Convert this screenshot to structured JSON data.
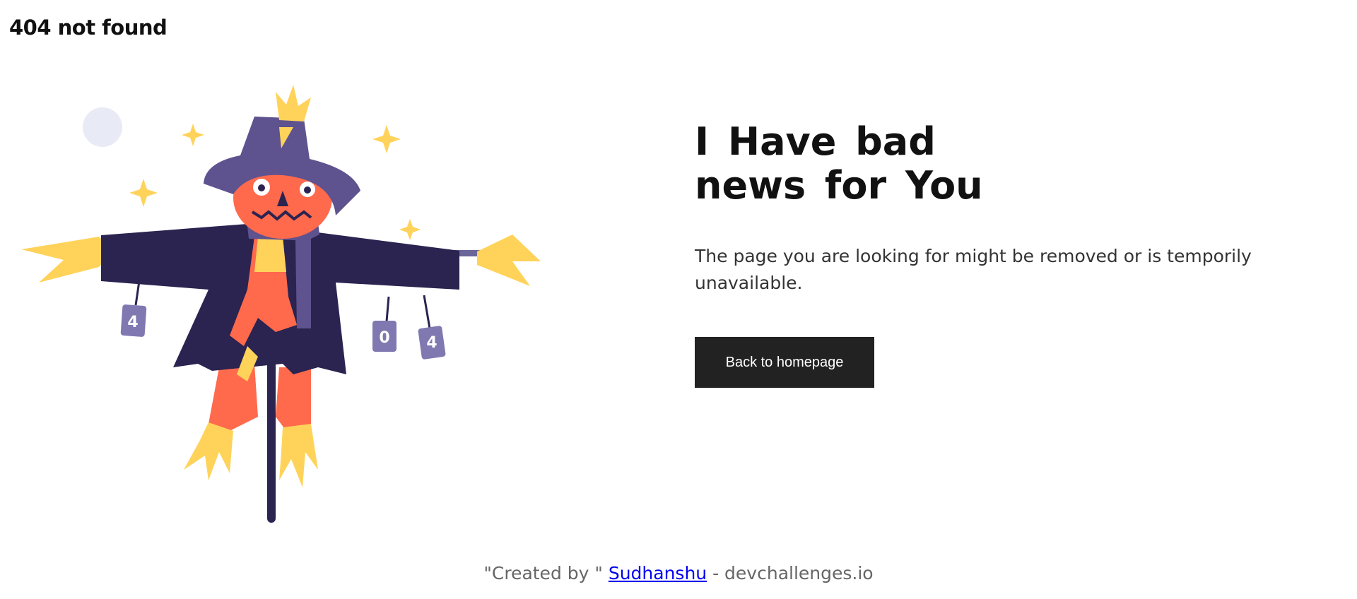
{
  "header": {
    "title": "404 not found"
  },
  "illustration": {
    "can_labels": [
      "4",
      "0",
      "4"
    ],
    "colors": {
      "coat": "#2b2350",
      "hat": "#5e528f",
      "face": "#ff6a4d",
      "straw": "#ffd35a",
      "can": "#8078b0",
      "moon": "#e8ebf5",
      "pole": "#2b2350"
    }
  },
  "main": {
    "headline": "I Have bad news for You",
    "message": "The page you are looking for might be removed or is temporily unavailable.",
    "button_label": "Back to homepage"
  },
  "footer": {
    "prefix": "\"Created by \"",
    "author": "Sudhanshu",
    "suffix": "- devchallenges.io"
  }
}
